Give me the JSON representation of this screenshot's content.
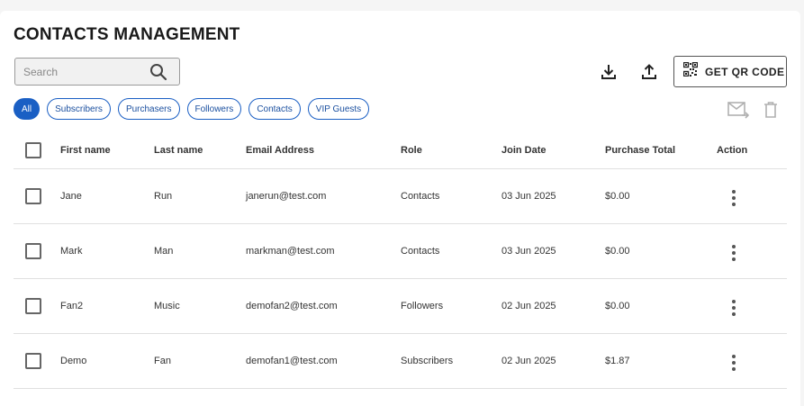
{
  "header": {
    "title": "CONTACTS MANAGEMENT"
  },
  "search": {
    "placeholder": "Search",
    "icon": "search-icon"
  },
  "toolbar": {
    "download_icon": "download-icon",
    "upload_icon": "upload-icon",
    "qr_label": "GET QR CODE",
    "qr_icon": "qr-code-icon"
  },
  "filters": [
    {
      "label": "All",
      "active": true
    },
    {
      "label": "Subscribers"
    },
    {
      "label": "Purchasers"
    },
    {
      "label": "Followers"
    },
    {
      "label": "Contacts"
    },
    {
      "label": "VIP Guests"
    }
  ],
  "bulk_actions": {
    "email_icon": "email-send-icon",
    "delete_icon": "trash-icon"
  },
  "table": {
    "columns": [
      "First name",
      "Last name",
      "Email Address",
      "Role",
      "Join Date",
      "Purchase Total",
      "Action"
    ],
    "rows": [
      {
        "first": "Jane",
        "last": "Run",
        "email": "janerun@test.com",
        "role": "Contacts",
        "date": "03 Jun 2025",
        "total": "$0.00"
      },
      {
        "first": "Mark",
        "last": "Man",
        "email": "markman@test.com",
        "role": "Contacts",
        "date": "03 Jun 2025",
        "total": "$0.00"
      },
      {
        "first": "Fan2",
        "last": "Music",
        "email": "demofan2@test.com",
        "role": "Followers",
        "date": "02 Jun 2025",
        "total": "$0.00"
      },
      {
        "first": "Demo",
        "last": "Fan",
        "email": "demofan1@test.com",
        "role": "Subscribers",
        "date": "02 Jun 2025",
        "total": "$1.87"
      }
    ]
  },
  "colors": {
    "accent": "#1a5fc4",
    "disabled_icon": "#b0b0b0"
  }
}
